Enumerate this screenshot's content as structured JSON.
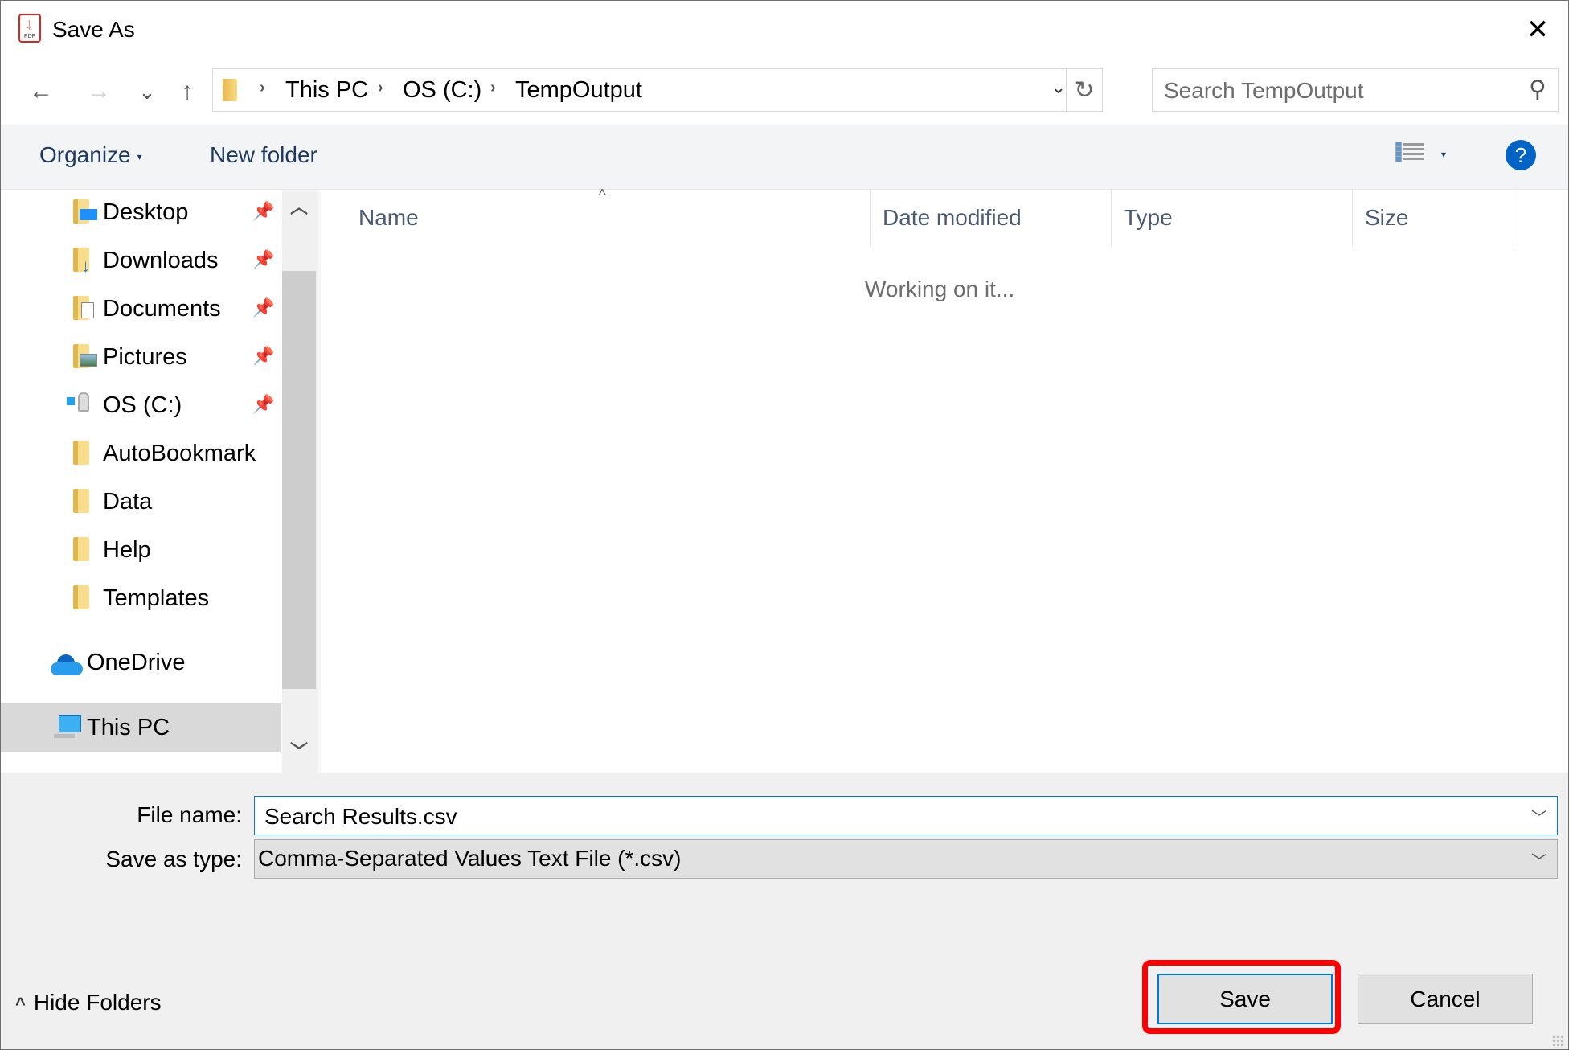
{
  "window": {
    "title": "Save As",
    "app_icon": "pdf-icon",
    "close_glyph": "✕"
  },
  "nav": {
    "back_glyph": "←",
    "forward_glyph": "→",
    "recent_glyph": "⌄",
    "up_glyph": "↑",
    "breadcrumb": [
      "This PC",
      "OS (C:)",
      "TempOutput"
    ],
    "separator_glyph": "›",
    "dropdown_glyph": "⌄",
    "refresh_glyph": "↻",
    "search_placeholder": "Search TempOutput",
    "search_glyph": "🔍"
  },
  "toolbar": {
    "organize_label": "Organize",
    "organize_caret": "▾",
    "new_folder_label": "New folder",
    "view_dropdown_caret": "▾",
    "help_label": "?"
  },
  "sidebar": {
    "items": [
      {
        "label": "Desktop",
        "icon": "desktop-folder-icon",
        "pinned": true
      },
      {
        "label": "Downloads",
        "icon": "downloads-folder-icon",
        "pinned": true
      },
      {
        "label": "Documents",
        "icon": "documents-folder-icon",
        "pinned": true
      },
      {
        "label": "Pictures",
        "icon": "pictures-folder-icon",
        "pinned": true
      },
      {
        "label": "OS (C:)",
        "icon": "drive-icon",
        "pinned": true
      },
      {
        "label": "AutoBookmark",
        "icon": "folder-icon",
        "pinned": false
      },
      {
        "label": "Data",
        "icon": "folder-icon",
        "pinned": false
      },
      {
        "label": "Help",
        "icon": "folder-icon",
        "pinned": false
      },
      {
        "label": "Templates",
        "icon": "folder-icon",
        "pinned": false
      },
      {
        "label": "OneDrive",
        "icon": "onedrive-icon",
        "pinned": false
      },
      {
        "label": "This PC",
        "icon": "this-pc-icon",
        "pinned": false,
        "selected": true
      }
    ],
    "pin_glyph": "📌",
    "scroll_up_glyph": "⌃",
    "scroll_down_glyph": "⌄"
  },
  "file_list": {
    "columns": [
      "Name",
      "Date modified",
      "Type",
      "Size"
    ],
    "sort_glyph": "^",
    "status": "Working on it..."
  },
  "bottom": {
    "file_name_label": "File name:",
    "file_name_value": "Search Results.csv",
    "save_as_type_label": "Save as type:",
    "save_as_type_value": "Comma-Separated Values Text File (*.csv)",
    "dropdown_glyph": "﹀",
    "hide_folders_label": "Hide Folders",
    "hide_folders_glyph": "^",
    "save_label": "Save",
    "cancel_label": "Cancel"
  },
  "colors": {
    "accent": "#0078d7",
    "help_blue": "#0063c6",
    "highlight_red": "#ff0000",
    "toolbar_bg": "#f3f4f6",
    "bottom_bg": "#f0f0f0",
    "selected_bg": "#d9d9d9"
  }
}
